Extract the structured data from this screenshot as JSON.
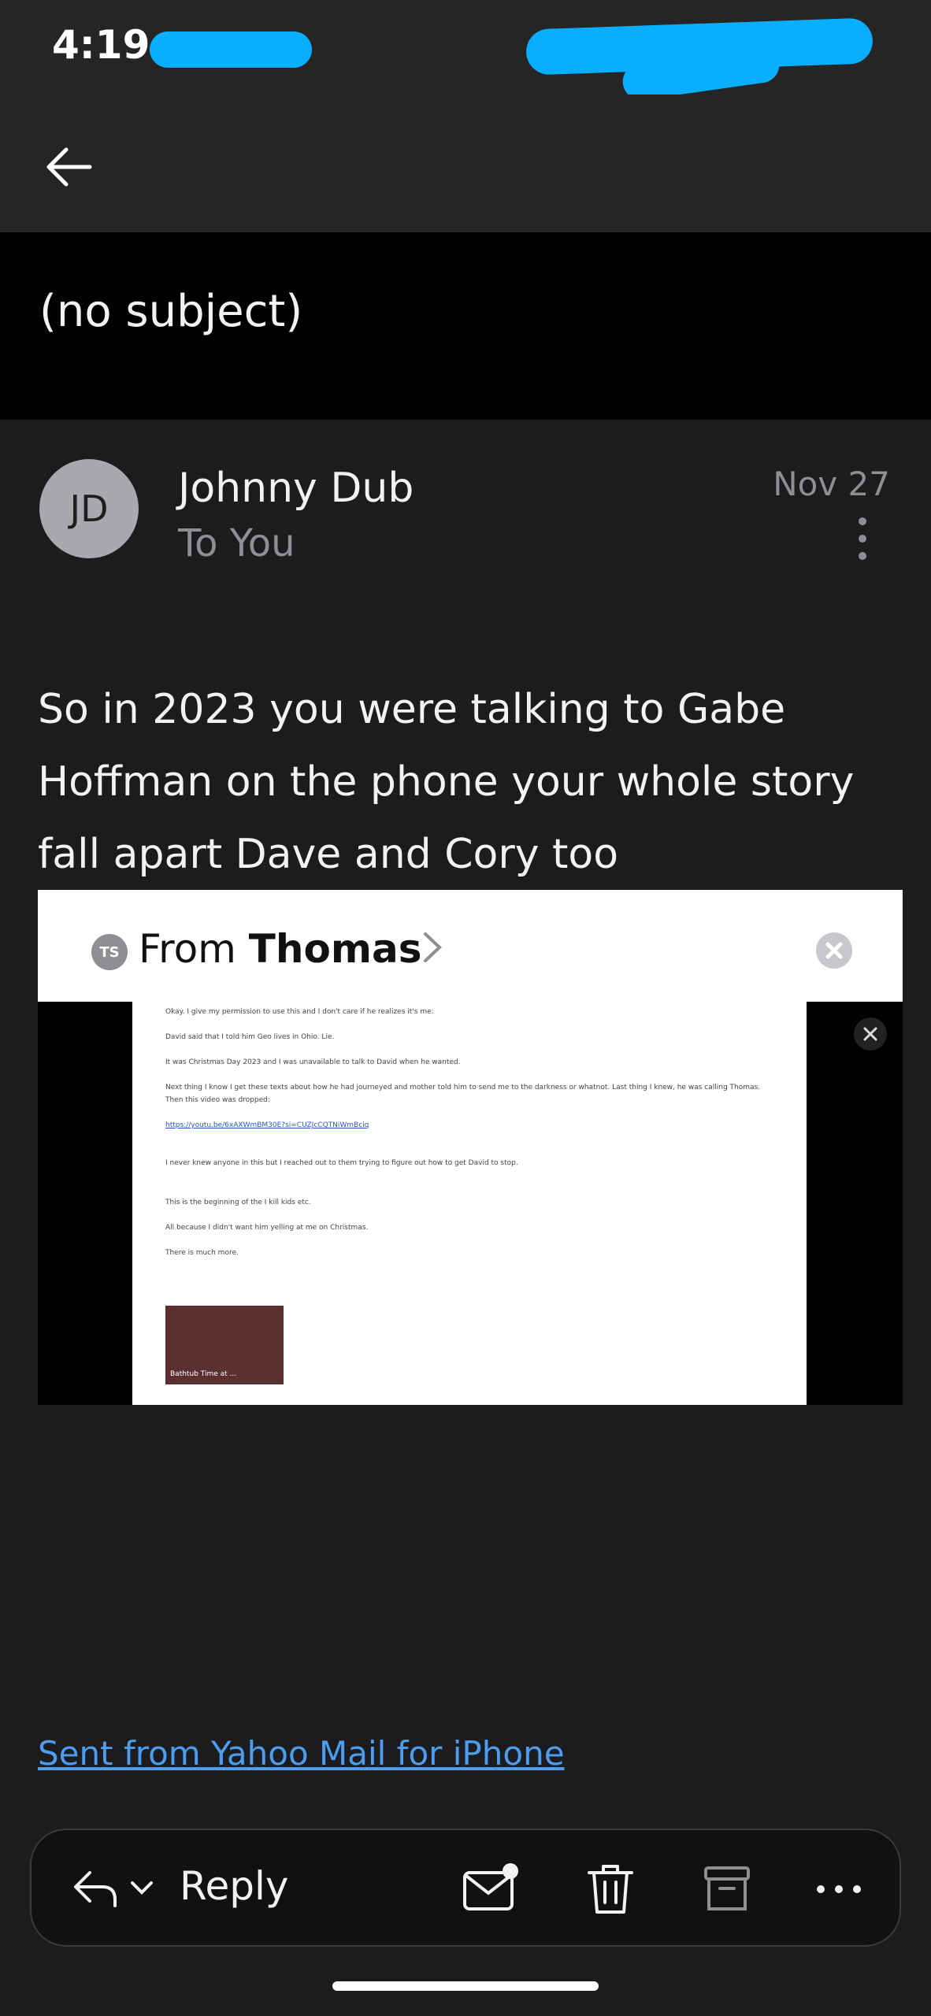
{
  "status_bar": {
    "time": "4:19"
  },
  "header": {
    "back_icon": "arrow-left-icon"
  },
  "email": {
    "subject": "(no subject)",
    "sender_initials": "JD",
    "sender_name": "Johnny Dub",
    "recipient_line": "To You",
    "date": "Nov 27",
    "body": "So in 2023 you were talking to Gabe Hoffman on the phone your whole story fall apart Dave and Cory too",
    "signature": "Sent from Yahoo Mail for iPhone"
  },
  "attachment": {
    "badge": "TS",
    "from_prefix": "From",
    "from_name": "Thomas",
    "doc_lines": [
      "Okay. I give my permission to use this and I don't care if he realizes it's me:",
      "David said that I told him Geo lives in Ohio. Lie.",
      "It was Christmas Day 2023 and I was unavailable to talk to David when he wanted.",
      "Next thing I know I get these texts about how he had journeyed and mother told him to send me to the darkness or whatnot. Last thing I knew, he was calling Thomas.",
      "Then this video was dropped:",
      "I never knew anyone in this but I reached out to them trying to figure out how to get David to stop.",
      "This is the beginning of the I kill kids etc.",
      "All because I didn't want him yelling at me on Christmas.",
      "There is much more."
    ],
    "doc_link": "https://youtu.be/6xAXWmBM30E?si=CUZJcCQTNiWmBciq",
    "thumb_label": "Bathtub Time at ..."
  },
  "toolbar": {
    "reply_label": "Reply",
    "icons": [
      "reply-icon",
      "chevron-down-icon",
      "mark-unread-icon",
      "trash-icon",
      "archive-icon",
      "more-icon"
    ]
  }
}
